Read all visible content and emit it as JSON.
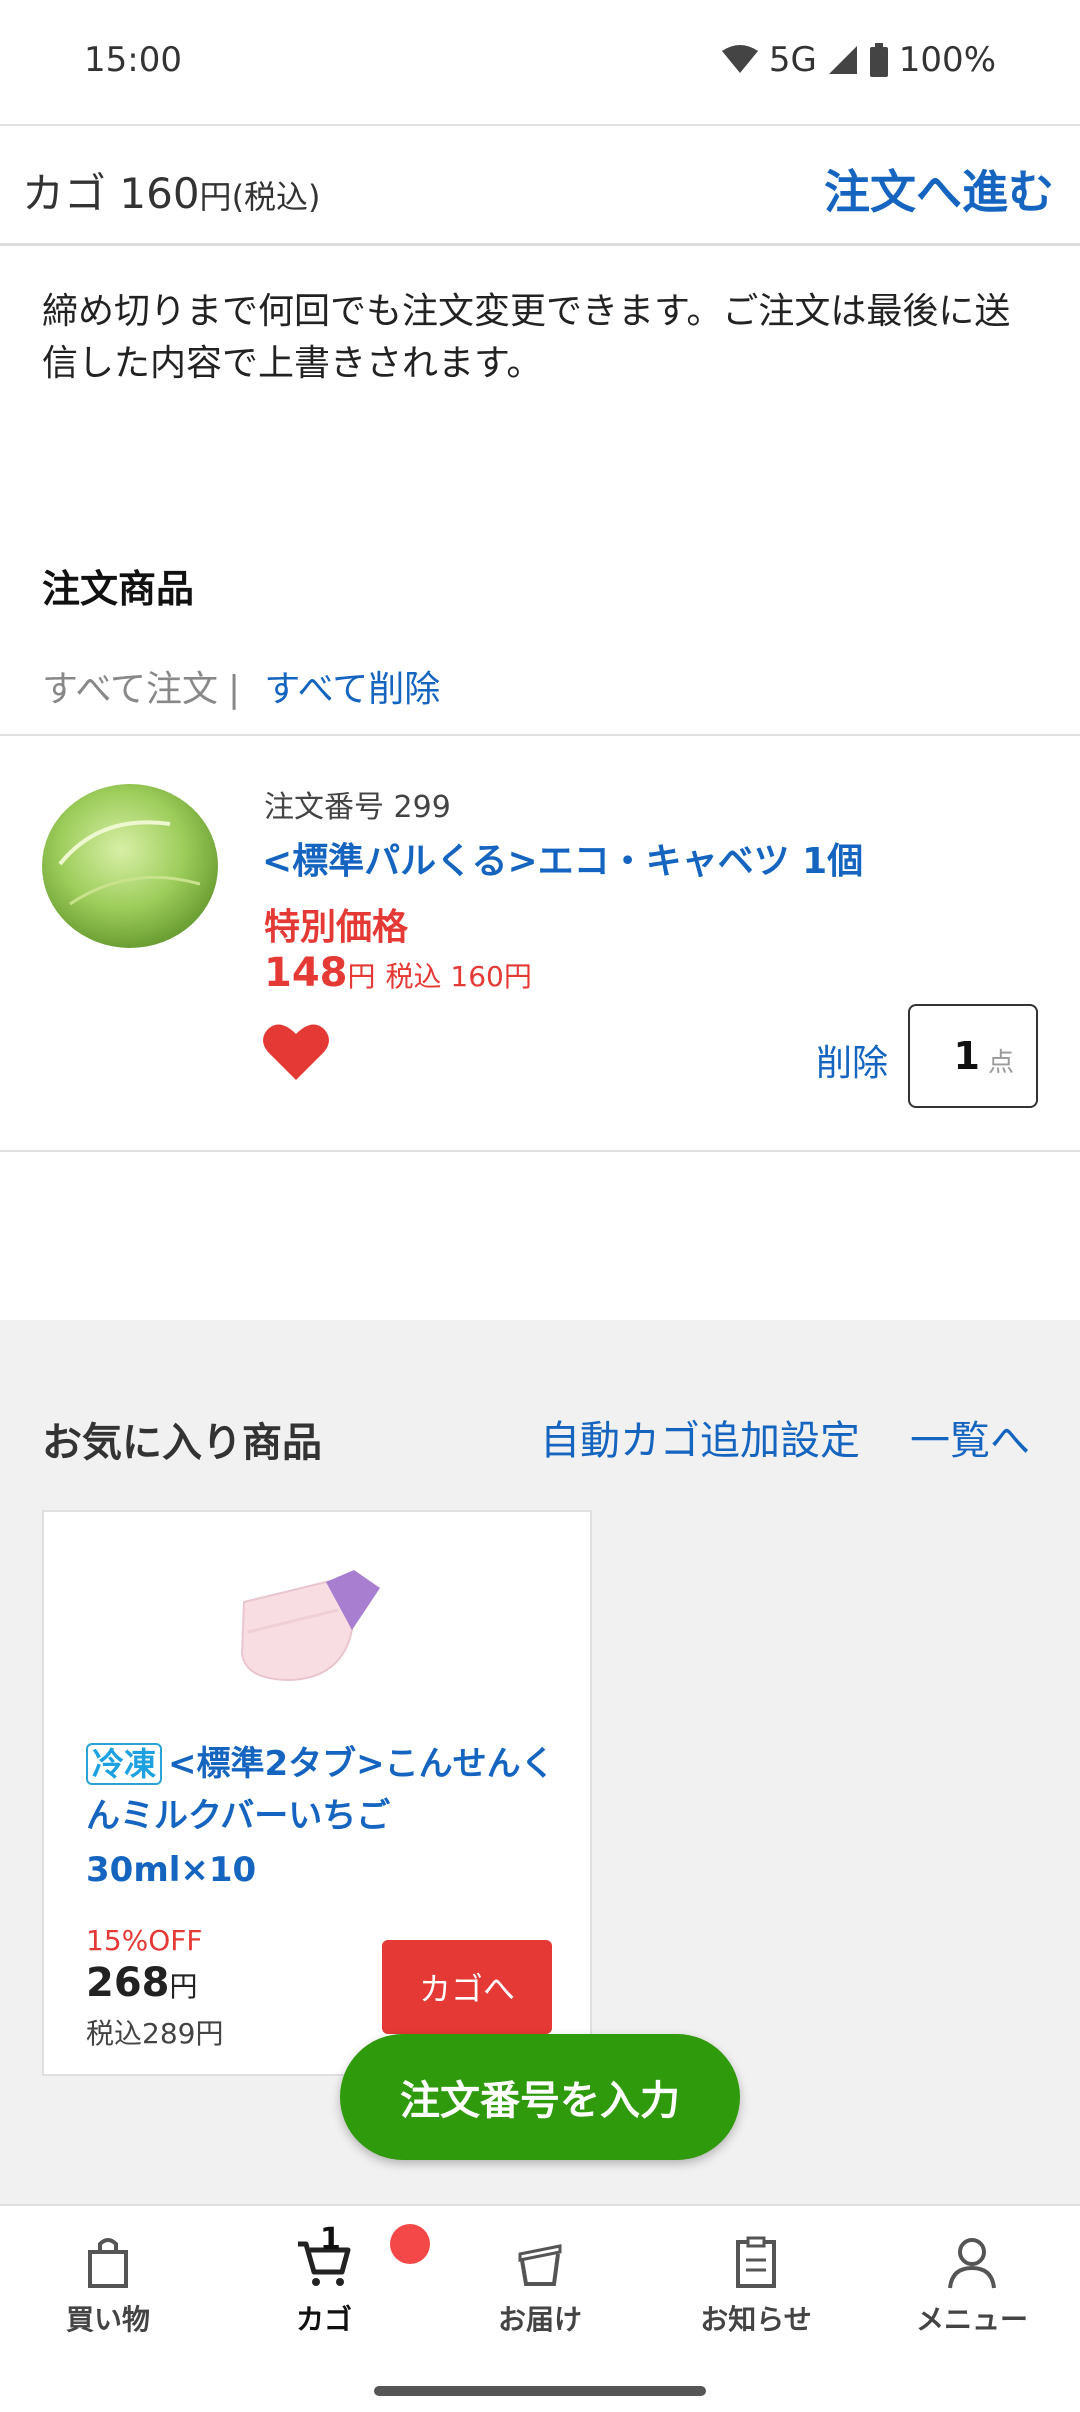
{
  "status_bar": {
    "time": "15:00",
    "network": "5G",
    "battery": "100%"
  },
  "header": {
    "cart_label": "カゴ",
    "cart_total": "160",
    "currency": "円",
    "tax_note": "(税込)",
    "checkout": "注文へ進む"
  },
  "notice": "締め切りまで何回でも注文変更できます。ご注文は最後に送信した内容で上書きされます。",
  "order_section": {
    "title": "注文商品",
    "order_all": "すべて注文",
    "separator": "|",
    "delete_all": "すべて削除",
    "item": {
      "order_number": "注文番号 299",
      "name": "<標準パルくる>エコ・キャベツ 1個",
      "special_label": "特別価格",
      "price": "148",
      "currency": "円",
      "tax_price": "税込 160円",
      "delete": "削除",
      "quantity": "1",
      "quantity_unit": "点",
      "favorite_icon": "heart-icon"
    }
  },
  "favorites": {
    "title": "お気に入り商品",
    "auto_cart": "自動カゴ追加設定",
    "view_list": "一覧へ",
    "item": {
      "badge": "冷凍",
      "name": "<標準2タブ>こんせんくんミルクバーいちご",
      "size": "30ml×10",
      "discount": "15%OFF",
      "price": "268",
      "currency": "円",
      "tax_price": "税込289円",
      "cart_button": "カゴへ"
    }
  },
  "fab": {
    "label": "注文番号を入力"
  },
  "bottom_nav": {
    "items": [
      {
        "label": "買い物",
        "icon": "shopping-bag-icon"
      },
      {
        "label": "カゴ",
        "icon": "cart-icon",
        "badge": "1"
      },
      {
        "label": "お届け",
        "icon": "delivery-box-icon"
      },
      {
        "label": "お知らせ",
        "icon": "clipboard-icon"
      },
      {
        "label": "メニュー",
        "icon": "person-icon"
      }
    ]
  },
  "colors": {
    "link_blue": "#1565c0",
    "price_red": "#e53935",
    "fab_green": "#2e9a0c",
    "fav_bg": "#f1f1f1"
  }
}
